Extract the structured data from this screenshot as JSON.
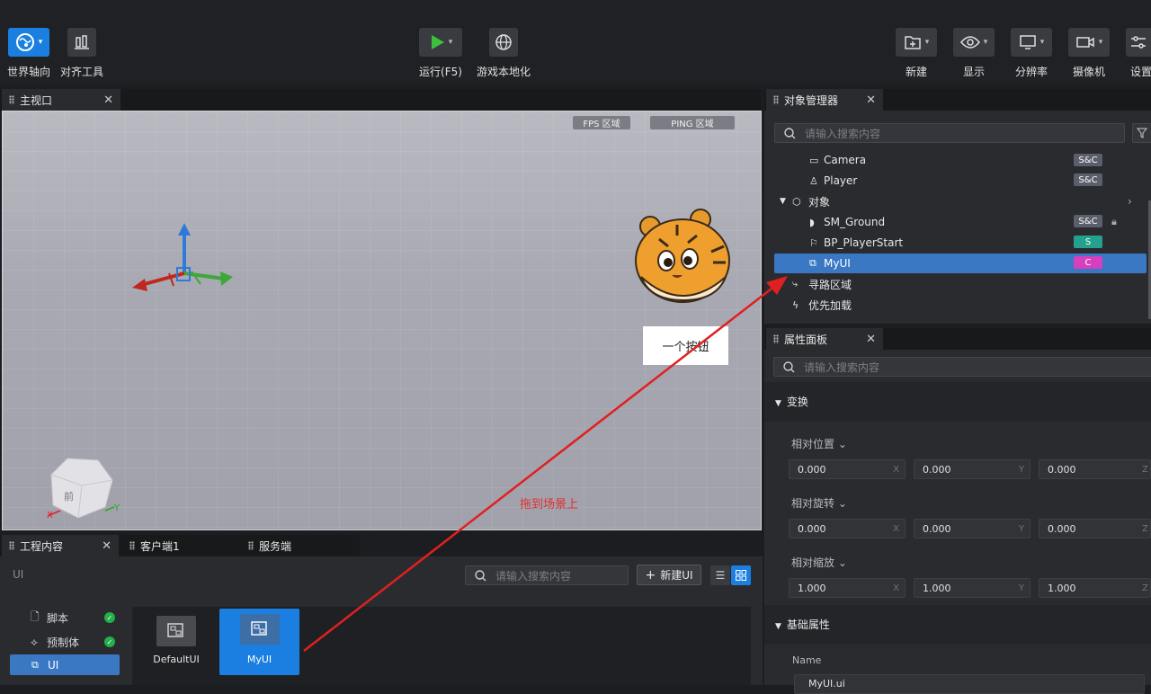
{
  "toolbar": {
    "left": [
      {
        "label": "世界轴向",
        "icon": "globe-axis-icon"
      },
      {
        "label": "对齐工具",
        "icon": "align-icon"
      }
    ],
    "center": [
      {
        "label": "运行(F5)",
        "icon": "play-icon"
      },
      {
        "label": "游戏本地化",
        "icon": "globe-icon"
      }
    ],
    "right": [
      {
        "label": "新建",
        "icon": "new-folder-icon"
      },
      {
        "label": "显示",
        "icon": "eye-icon"
      },
      {
        "label": "分辨率",
        "icon": "monitor-icon"
      },
      {
        "label": "摄像机",
        "icon": "camera-icon"
      },
      {
        "label": "设置",
        "icon": "sliders-icon"
      }
    ]
  },
  "viewport": {
    "tab": "主视口",
    "fps": "FPS 区域",
    "ping": "PING 区域",
    "button_text": "一个按钮",
    "cube_face": "前",
    "axis_x": "X",
    "axis_y": "Y",
    "annotation": "拖到场景上"
  },
  "project": {
    "tabs": [
      "工程内容",
      "客户端1",
      "服务端"
    ],
    "path": "UI",
    "search_placeholder": "请输入搜索内容",
    "new_button": "新建UI",
    "categories": [
      {
        "label": "脚本",
        "ok": true
      },
      {
        "label": "预制体",
        "ok": true
      },
      {
        "label": "UI",
        "ok": false
      }
    ],
    "assets": [
      {
        "label": "DefaultUI",
        "selected": false
      },
      {
        "label": "MyUI",
        "selected": true
      }
    ]
  },
  "object_manager": {
    "tab": "对象管理器",
    "search_placeholder": "请输入搜索内容",
    "rows": [
      {
        "label": "Camera",
        "badge": "S&C",
        "icon": "camera-icon"
      },
      {
        "label": "Player",
        "badge": "S&C",
        "icon": "person-icon"
      },
      {
        "label": "对象",
        "badge": "",
        "icon": "cube-icon"
      },
      {
        "label": "SM_Ground",
        "badge": "S&C",
        "icon": "mesh-icon"
      },
      {
        "label": "BP_PlayerStart",
        "badge": "S",
        "icon": "flag-icon"
      },
      {
        "label": "MyUI",
        "badge": "C",
        "icon": "ui-icon"
      },
      {
        "label": "寻路区域",
        "badge": "",
        "icon": "path-icon"
      },
      {
        "label": "优先加载",
        "badge": "",
        "icon": "bolt-icon"
      }
    ]
  },
  "properties": {
    "tab": "属性面板",
    "search_placeholder": "请输入搜索内容",
    "transform": "变换",
    "groups": [
      {
        "label": "相对位置",
        "values": [
          "0.000",
          "0.000",
          "0.000"
        ]
      },
      {
        "label": "相对旋转",
        "values": [
          "0.000",
          "0.000",
          "0.000"
        ]
      },
      {
        "label": "相对缩放",
        "values": [
          "1.000",
          "1.000",
          "1.000"
        ]
      }
    ],
    "axes": [
      "X",
      "Y",
      "Z"
    ],
    "basic": "基础属性",
    "name_label": "Name",
    "name_value": "MyUI.ui"
  },
  "colors": {
    "accent": "#1a7fe0",
    "selection": "#3a78c4",
    "badge_sc": "#5b5f6b",
    "badge_s": "#23a08e",
    "badge_c": "#d63fbd",
    "arrow": "#e02020"
  }
}
